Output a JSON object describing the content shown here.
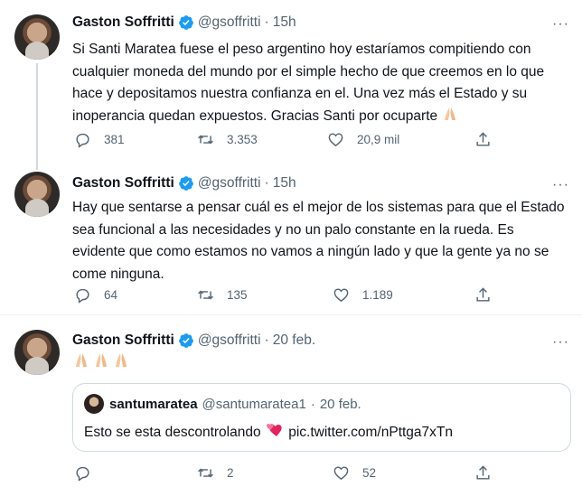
{
  "tweets": [
    {
      "name": "Gaston Soffritti",
      "handle": "@gsoffritti",
      "separator": "·",
      "time": "15h",
      "text": "Si Santi Maratea fuese el peso argentino hoy estaríamos compitiendo con cualquier moneda del mundo por el simple hecho de que creemos en lo que hace y depositamos nuestra confianza en el. Una vez más el Estado y su inoperancia quedan expuestos. Gracias Santi por ocuparte",
      "replies": "381",
      "retweets": "3.353",
      "likes": "20,9 mil"
    },
    {
      "name": "Gaston Soffritti",
      "handle": "@gsoffritti",
      "separator": "·",
      "time": "15h",
      "text": "Hay que sentarse a pensar cuál es el mejor de los sistemas para que el Estado sea funcional a las necesidades y no un palo constante en la rueda. Es evidente que como estamos no vamos a ningún lado y que la gente ya no se come ninguna.",
      "replies": "64",
      "retweets": "135",
      "likes": "1.189"
    },
    {
      "name": "Gaston Soffritti",
      "handle": "@gsoffritti",
      "separator": "·",
      "time": "20 feb.",
      "text": "",
      "replies": "",
      "retweets": "2",
      "likes": "52",
      "quote": {
        "name": "santumaratea",
        "handle": "@santumaratea1",
        "separator": "·",
        "time": "20 feb.",
        "text": "Esto se esta descontrolando",
        "link": "pic.twitter.com/nPttga7xTn"
      }
    }
  ],
  "icons": {
    "reply": "reply-icon",
    "retweet": "retweet-icon",
    "like": "like-icon",
    "share": "share-icon",
    "verified": "verified-badge-icon",
    "pray": "folded-hands-emoji",
    "heart": "two-hearts-emoji"
  },
  "colors": {
    "verified": "#1d9bf0",
    "secondary_text": "#536471",
    "thread_line": "#cfd9de"
  }
}
